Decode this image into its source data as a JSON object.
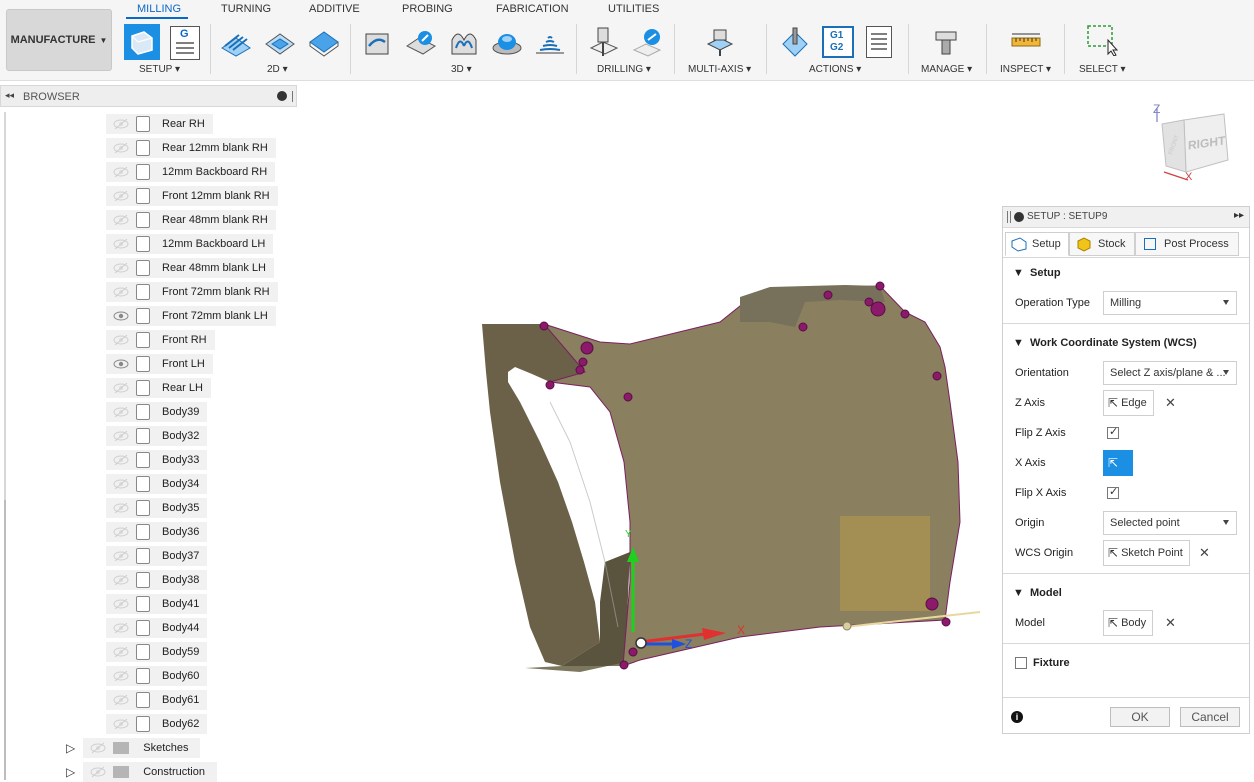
{
  "toolbar": {
    "workspace": "MANUFACTURE",
    "tabs": [
      "MILLING",
      "TURNING",
      "ADDITIVE",
      "PROBING",
      "FABRICATION",
      "UTILITIES"
    ],
    "groups": [
      "SETUP",
      "2D",
      "3D",
      "DRILLING",
      "MULTI-AXIS",
      "ACTIONS",
      "MANAGE",
      "INSPECT",
      "SELECT"
    ],
    "gcode_line1": "G1",
    "gcode_line2": "G2",
    "setup_sheet_letter": "G",
    "accent": "#0a69c6"
  },
  "browser": {
    "title": "BROWSER",
    "bodies": [
      {
        "label": "Rear RH",
        "visible": false
      },
      {
        "label": "Rear 12mm blank RH",
        "visible": false
      },
      {
        "label": "12mm Backboard RH",
        "visible": false
      },
      {
        "label": "Front 12mm blank RH",
        "visible": false
      },
      {
        "label": "Rear 48mm blank RH",
        "visible": false
      },
      {
        "label": "12mm Backboard LH",
        "visible": false
      },
      {
        "label": "Rear 48mm blank LH",
        "visible": false
      },
      {
        "label": "Front  72mm blank RH",
        "visible": false
      },
      {
        "label": "Front  72mm blank LH",
        "visible": true
      },
      {
        "label": "Front RH",
        "visible": false
      },
      {
        "label": "Front LH",
        "visible": true
      },
      {
        "label": "Rear LH",
        "visible": false
      },
      {
        "label": "Body39",
        "visible": false
      },
      {
        "label": "Body32",
        "visible": false
      },
      {
        "label": "Body33",
        "visible": false
      },
      {
        "label": "Body34",
        "visible": false
      },
      {
        "label": "Body35",
        "visible": false
      },
      {
        "label": "Body36",
        "visible": false
      },
      {
        "label": "Body37",
        "visible": false
      },
      {
        "label": "Body38",
        "visible": false
      },
      {
        "label": "Body41",
        "visible": false
      },
      {
        "label": "Body44",
        "visible": false
      },
      {
        "label": "Body59",
        "visible": false
      },
      {
        "label": "Body60",
        "visible": false
      },
      {
        "label": "Body61",
        "visible": false
      },
      {
        "label": "Body62",
        "visible": false
      }
    ],
    "folders": [
      {
        "label": "Sketches"
      },
      {
        "label": "Construction"
      }
    ]
  },
  "viewcube": {
    "face": "RIGHT",
    "side_face": "FRONT",
    "axis_z": "Z",
    "axis_x": "X"
  },
  "viewport": {
    "triad_x": "X",
    "triad_z": "Z",
    "triad_y": "Y",
    "body_color": "#8a7f5e"
  },
  "panel": {
    "title": "SETUP : SETUP9",
    "tabs": [
      "Setup",
      "Stock",
      "Post Process"
    ],
    "setup_section": "Setup",
    "operation_type_label": "Operation Type",
    "operation_type_value": "Milling",
    "wcs_section": "Work Coordinate System (WCS)",
    "orientation_label": "Orientation",
    "orientation_value": "Select Z axis/plane & ...",
    "z_axis_label": "Z Axis",
    "z_axis_value": "Edge",
    "flip_z_label": "Flip Z Axis",
    "flip_z_checked": true,
    "x_axis_label": "X Axis",
    "flip_x_label": "Flip X Axis",
    "flip_x_checked": true,
    "origin_label": "Origin",
    "origin_value": "Selected point",
    "wcs_origin_label": "WCS Origin",
    "wcs_origin_value": "Sketch Point",
    "model_section": "Model",
    "model_label": "Model",
    "model_value": "Body",
    "fixture_label": "Fixture",
    "fixture_checked": false,
    "ok": "OK",
    "cancel": "Cancel",
    "info_icon": "i"
  }
}
